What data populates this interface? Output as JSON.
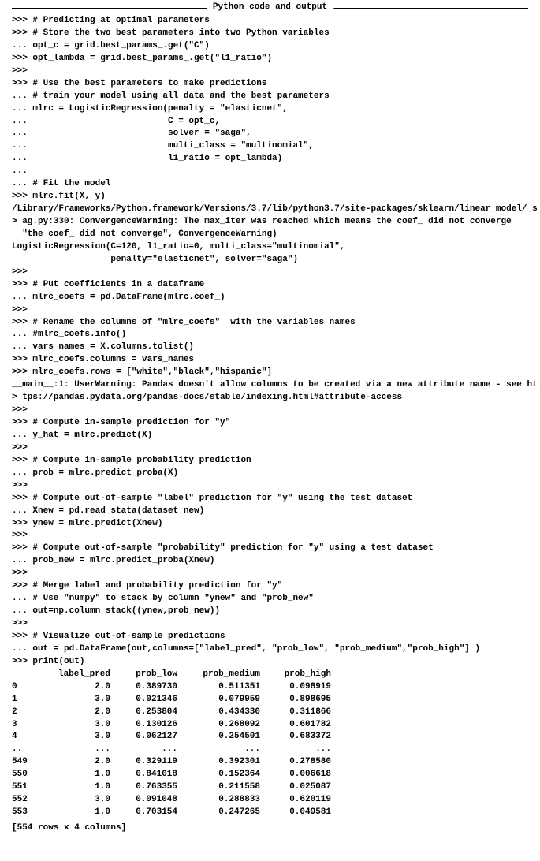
{
  "frame_title": "Python code and output",
  "code_lines": [
    ">>> # Predicting at optimal parameters",
    ">>> # Store the two best parameters into two Python variables",
    "... opt_c = grid.best_params_.get(\"C\")",
    ">>> opt_lambda = grid.best_params_.get(\"l1_ratio\")",
    ">>>",
    ">>> # Use the best parameters to make predictions",
    "... # train your model using all data and the best parameters",
    "... mlrc = LogisticRegression(penalty = \"elasticnet\",",
    "...                           C = opt_c,",
    "...                           solver = \"saga\",",
    "...                           multi_class = \"multinomial\",",
    "...                           l1_ratio = opt_lambda)",
    "...",
    "... # Fit the model",
    ">>> mlrc.fit(X, y)",
    "/Library/Frameworks/Python.framework/Versions/3.7/lib/python3.7/site-packages/sklearn/linear_model/_s",
    "> ag.py:330: ConvergenceWarning: The max_iter was reached which means the coef_ did not converge",
    "  \"the coef_ did not converge\", ConvergenceWarning)",
    "LogisticRegression(C=120, l1_ratio=0, multi_class=\"multinomial\",",
    "                   penalty=\"elasticnet\", solver=\"saga\")",
    ">>>",
    ">>> # Put coefficients in a dataframe",
    "... mlrc_coefs = pd.DataFrame(mlrc.coef_)",
    ">>>",
    ">>> # Rename the columns of \"mlrc_coefs\"  with the variables names",
    "... #mlrc_coefs.info()",
    "... vars_names = X.columns.tolist()",
    ">>> mlrc_coefs.columns = vars_names",
    ">>> mlrc_coefs.rows = [\"white\",\"black\",\"hispanic\"]",
    "__main__:1: UserWarning: Pandas doesn't allow columns to be created via a new attribute name - see ht",
    "> tps://pandas.pydata.org/pandas-docs/stable/indexing.html#attribute-access",
    ">>>",
    ">>> # Compute in-sample prediction for \"y\"",
    "... y_hat = mlrc.predict(X)",
    ">>>",
    ">>> # Compute in-sample probability prediction",
    "... prob = mlrc.predict_proba(X)",
    ">>>",
    ">>> # Compute out-of-sample \"label\" prediction for \"y\" using the test dataset",
    "... Xnew = pd.read_stata(dataset_new)",
    ">>> ynew = mlrc.predict(Xnew)",
    ">>>",
    ">>> # Compute out-of-sample \"probability\" prediction for \"y\" using a test dataset",
    "... prob_new = mlrc.predict_proba(Xnew)",
    ">>>",
    ">>> # Merge label and probability prediction for \"y\"",
    "... # Use \"numpy\" to stack by column \"ynew\" and \"prob_new\"",
    "... out=np.column_stack((ynew,prob_new))",
    ">>>",
    ">>> # Visualize out-of-sample predictions",
    "... out = pd.DataFrame(out,columns=[\"label_pred\", \"prob_low\", \"prob_medium\",\"prob_high\"] )",
    ">>> print(out)"
  ],
  "table": {
    "headers": [
      "",
      "label_pred",
      "prob_low",
      "prob_medium",
      "prob_high"
    ],
    "rows": [
      [
        "0",
        "2.0",
        "0.389730",
        "0.511351",
        "0.098919"
      ],
      [
        "1",
        "3.0",
        "0.021346",
        "0.079959",
        "0.898695"
      ],
      [
        "2",
        "2.0",
        "0.253804",
        "0.434330",
        "0.311866"
      ],
      [
        "3",
        "3.0",
        "0.130126",
        "0.268092",
        "0.601782"
      ],
      [
        "4",
        "3.0",
        "0.062127",
        "0.254501",
        "0.683372"
      ],
      [
        "..",
        "...",
        "...",
        "...",
        "..."
      ],
      [
        "549",
        "2.0",
        "0.329119",
        "0.392301",
        "0.278580"
      ],
      [
        "550",
        "1.0",
        "0.841018",
        "0.152364",
        "0.006618"
      ],
      [
        "551",
        "1.0",
        "0.763355",
        "0.211558",
        "0.025087"
      ],
      [
        "552",
        "3.0",
        "0.091048",
        "0.288833",
        "0.620119"
      ],
      [
        "553",
        "1.0",
        "0.703154",
        "0.247265",
        "0.049581"
      ]
    ],
    "footer": "[554 rows x 4 columns]"
  }
}
